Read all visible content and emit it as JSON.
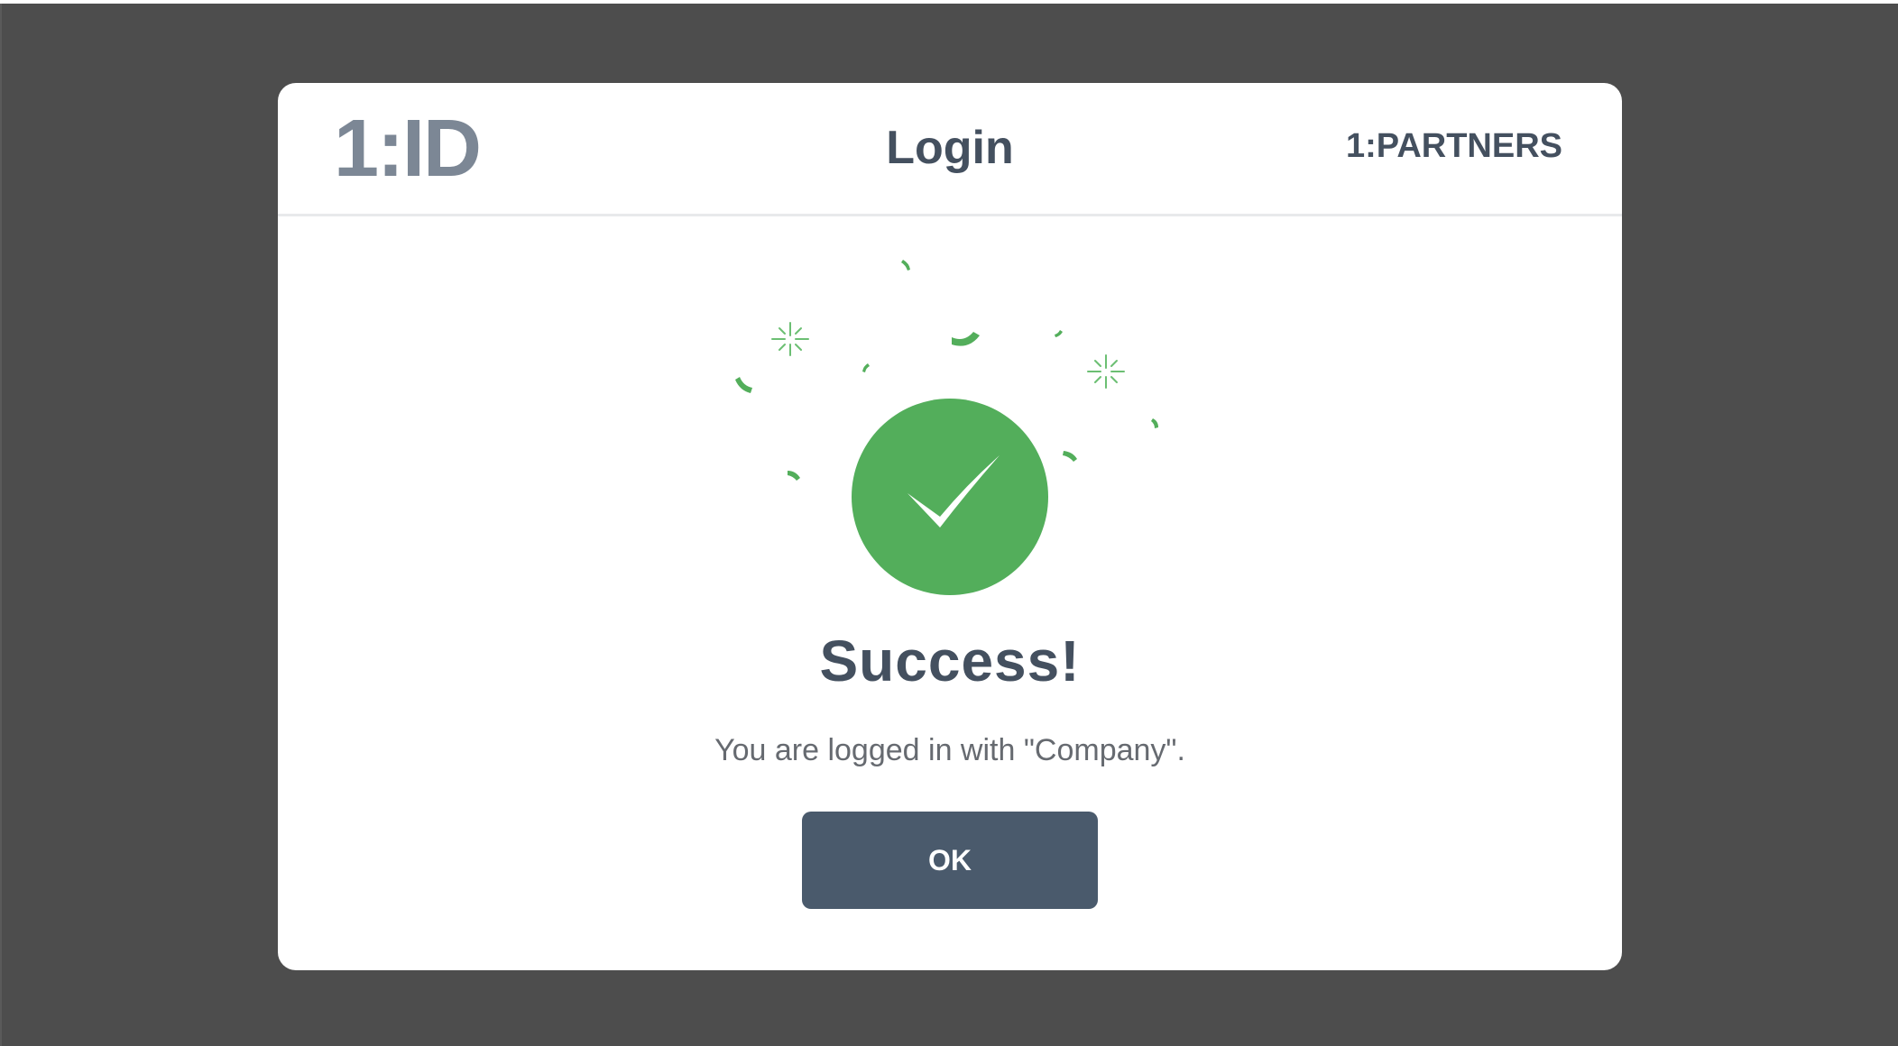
{
  "header": {
    "logo_text": "1:ID",
    "title": "Login",
    "partner_text": "1:PARTNERS"
  },
  "result": {
    "icon": "checkmark-icon",
    "title": "Success!",
    "message": "You are logged in with \"Company\".",
    "ok_label": "OK"
  },
  "colors": {
    "backdrop": "#4d4d4d",
    "modal": "#ffffff",
    "accent_green": "#53ae5b",
    "heading_text": "#44505f",
    "logo_text": "#7c8795",
    "body_text": "#666a70",
    "button": "#4a5a6c"
  }
}
